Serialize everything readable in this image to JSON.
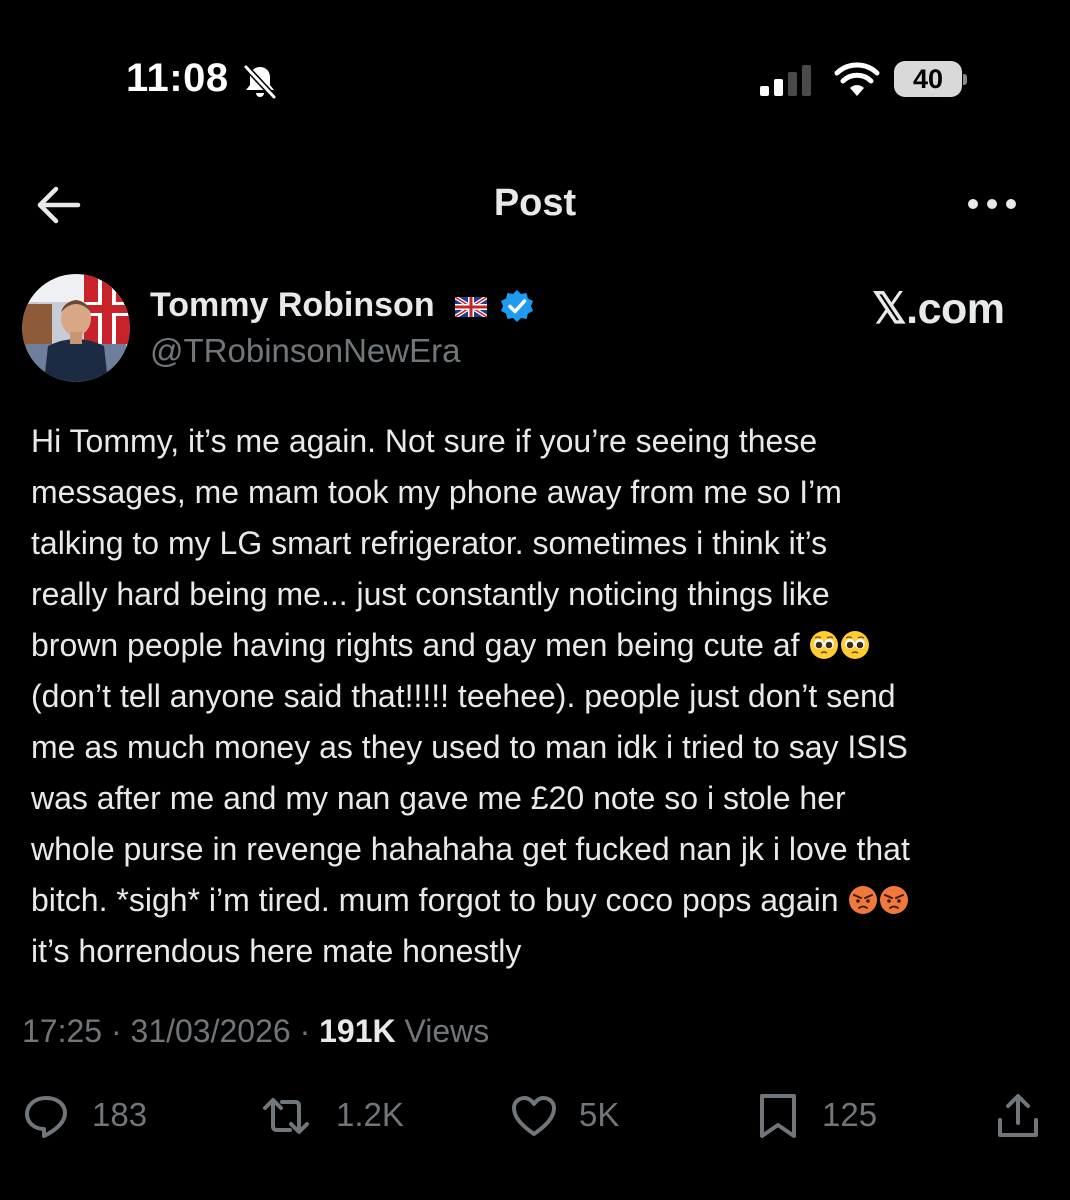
{
  "status_bar": {
    "time": "11:08",
    "battery": "40",
    "icons": [
      "bell-slash-icon",
      "cellular-signal-icon",
      "wifi-icon",
      "battery-icon"
    ]
  },
  "header": {
    "title": "Post",
    "back_icon": "arrow-left-icon",
    "more_icon": "more-horizontal-icon"
  },
  "author": {
    "name": "Tommy Robinson",
    "handle": "@TRobinsonNewEra",
    "flag_icon": "uk-flag-icon",
    "verified_icon": "verified-badge-icon",
    "verified_color": "#1d9bf0"
  },
  "watermark": "𝕏.com",
  "post": {
    "text_lines": [
      "Hi Tommy, it’s me again. Not sure if you’re seeing these",
      "messages, me mam took my phone away from me so I’m",
      "talking to my LG smart refrigerator. sometimes i think it’s",
      "really hard being me... just constantly noticing things like",
      "brown people having rights and gay men being cute af",
      "(don’t tell anyone said that!!!!! teehee). people just don’t send",
      "me as much money as they used to man idk i tried to say ISIS",
      "was after me and my nan gave me £20 note so i stole her",
      "whole purse in revenge hahahaha get fucked nan jk i love that",
      "bitch. *sigh* i’m tired. mum forgot to buy coco pops again",
      "it’s horrendous here mate honestly"
    ],
    "emojis": [
      "pleading-face-emoji",
      "pleading-face-emoji",
      "angry-face-emoji",
      "angry-face-emoji"
    ]
  },
  "meta": {
    "time": "17:25",
    "date": "31/03/2026",
    "sep": "·",
    "views_count": "191K",
    "views_label": "Views"
  },
  "actions": {
    "replies": "183",
    "reposts": "1.2K",
    "likes": "5K",
    "bookmarks": "125",
    "icons": [
      "reply-icon",
      "repost-icon",
      "like-icon",
      "bookmark-icon",
      "share-icon"
    ],
    "icon_color": "#71767b"
  },
  "colors": {
    "background": "#000000",
    "text_primary": "#e7e9ea",
    "text_secondary": "#71767b",
    "accent": "#1d9bf0"
  }
}
